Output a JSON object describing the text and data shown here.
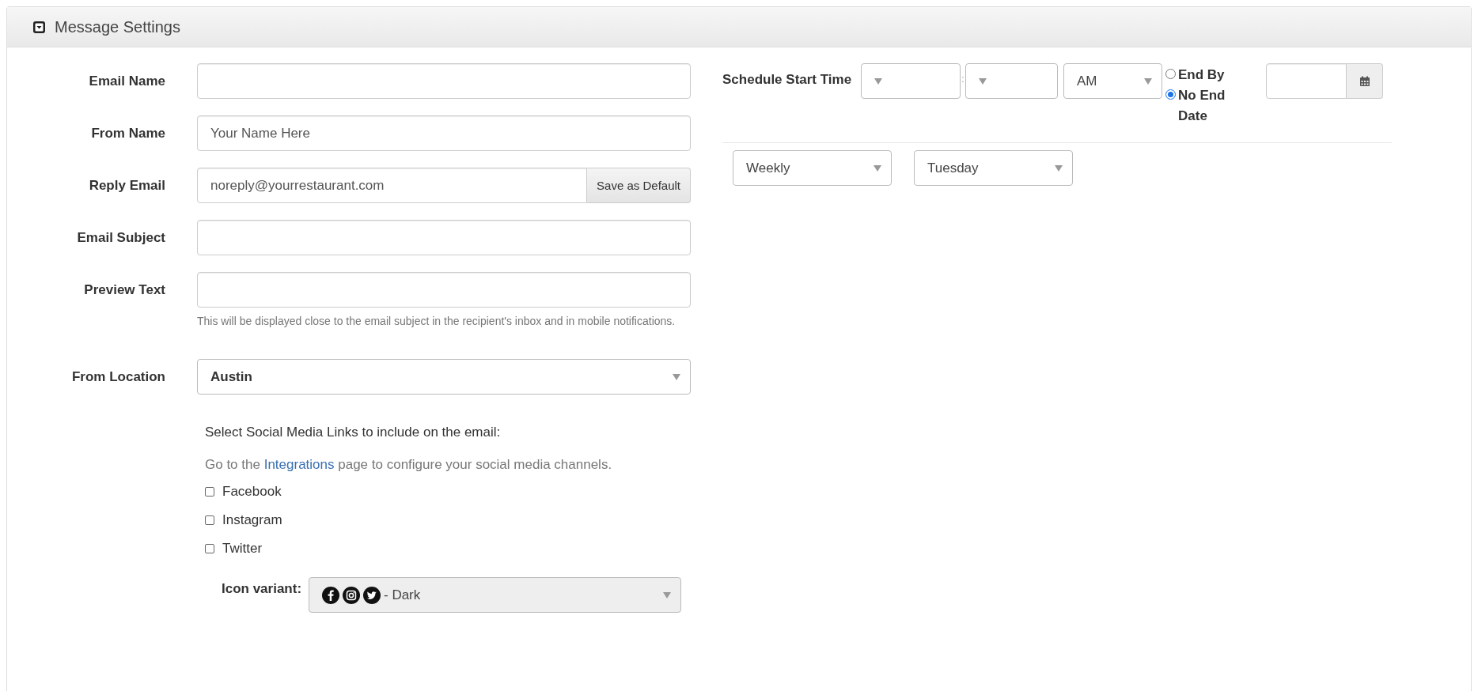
{
  "panel": {
    "title": "Message Settings"
  },
  "fields": [
    {
      "kind": "text",
      "label": "Email Name"
    },
    {
      "kind": "text",
      "label": "From Name",
      "value": "Your Name Here"
    },
    {
      "kind": "addon",
      "label": "Reply Email",
      "value": "noreply@yourrestaurant.com",
      "button": "Save as Default"
    },
    {
      "kind": "text",
      "label": "Email Subject"
    },
    {
      "kind": "text",
      "label": "Preview Text",
      "help": "This will be displayed close to the email subject in the recipient's inbox and in mobile notifications."
    },
    {
      "kind": "select",
      "label": "From Location",
      "value": "Austin"
    }
  ],
  "social": {
    "intro": "Select Social Media Links to include on the email:",
    "note_before": "Go to the ",
    "link": "Integrations",
    "note_after": " page to configure your social media channels.",
    "options": [
      {
        "label": "Facebook",
        "checked": false
      },
      {
        "label": "Instagram",
        "checked": false
      },
      {
        "label": "Twitter",
        "checked": false
      }
    ],
    "icon_variant": {
      "label": "Icon variant:",
      "value": "- Dark"
    }
  },
  "schedule": {
    "label": "Schedule Start Time",
    "separator": ":",
    "ampm": "AM",
    "end_options": [
      {
        "label": "End By",
        "selected": false
      },
      {
        "label": "No End Date",
        "selected": true
      }
    ],
    "recurrence": [
      "Weekly",
      "Tuesday"
    ]
  }
}
